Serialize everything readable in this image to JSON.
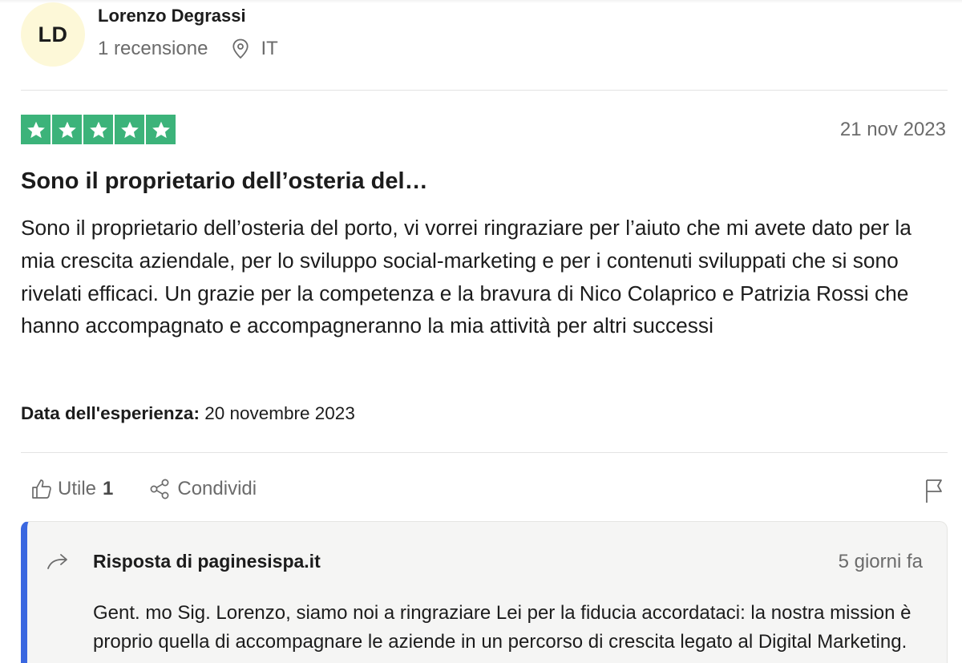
{
  "reviewer": {
    "initials": "LD",
    "name": "Lorenzo Degrassi",
    "reviews_count": "1 recensione",
    "country": "IT"
  },
  "review": {
    "rating": 5,
    "rating_max": 5,
    "date": "21 nov 2023",
    "title": "Sono il proprietario dell’osteria del…",
    "body": "Sono il proprietario dell’osteria del porto, vi vorrei ringraziare per l’aiuto che mi avete dato per la mia crescita aziendale, per lo sviluppo social-marketing e per i contenuti sviluppati che si sono rivelati efficaci. Un grazie per la competenza e la bravura di Nico Colaprico e Patrizia Rossi che hanno accompagnato e accompagneranno la mia attività per altri successi",
    "experience_label": "Data dell'esperienza:",
    "experience_date": "20 novembre 2023",
    "star_color": "#3cb37a"
  },
  "actions": {
    "useful_label": "Utile",
    "useful_count": "1",
    "share_label": "Condividi",
    "icons": [
      "thumbs-up-icon",
      "share-icon",
      "flag-icon"
    ]
  },
  "reply": {
    "title": "Risposta di paginesispa.it",
    "date": "5 giorni fa",
    "body": "Gent. mo Sig. Lorenzo, siamo noi a ringraziare Lei per la fiducia accordataci: la nostra mission è proprio quella di accompagnare le aziende in un percorso di crescita legato al Digital Marketing.",
    "accent_color": "#3a67e0"
  }
}
